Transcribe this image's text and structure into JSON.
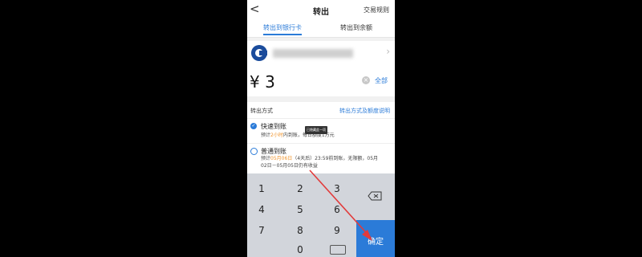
{
  "nav": {
    "back": "<",
    "title": "转出",
    "rules": "交易规则"
  },
  "tabs": [
    {
      "label": "转出到银行卡"
    },
    {
      "label": "转出到余额"
    }
  ],
  "bank": {
    "arrow": "›"
  },
  "amount": {
    "value": "¥ 3",
    "clear": "×",
    "all": "全部"
  },
  "method": {
    "label": "转出方式",
    "link": "转出方式及额度说明"
  },
  "options": [
    {
      "title": "快速到账",
      "desc_pre": "预计",
      "desc_hl": "2小时",
      "desc_post": "内到账，每日额度1万元"
    },
    {
      "title": "普通到账",
      "desc_pre": "预计",
      "desc_hl": "05月06日",
      "desc_post": "（4天后）23:59前到账，无限额，05月",
      "desc2": "02日－05月05日仍有收益"
    }
  ],
  "tooltip": "已隐藏此一项",
  "keypad": {
    "keys": [
      "1",
      "2",
      "3",
      "4",
      "5",
      "6",
      "7",
      "8",
      "9",
      "0"
    ],
    "confirm": "确定"
  },
  "colors": {
    "accent": "#2b7bd8",
    "highlight": "#f0952d",
    "arrow": "#e23b3b"
  }
}
